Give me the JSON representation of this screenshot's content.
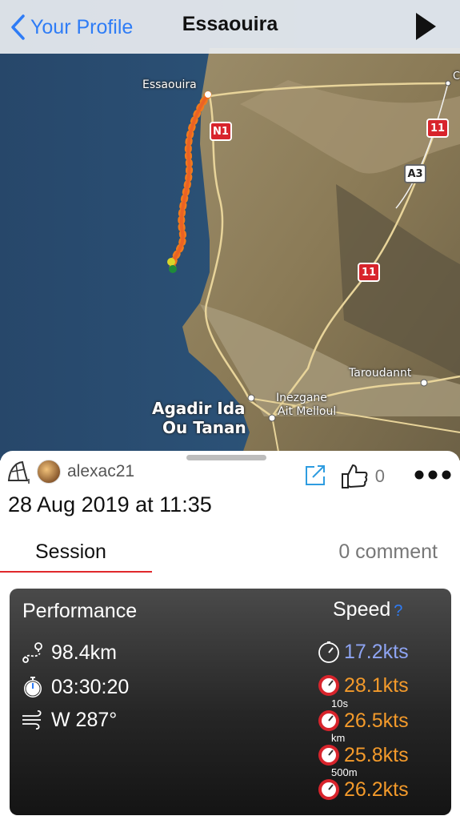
{
  "nav": {
    "back_label": "Your Profile",
    "title": "Essaouira"
  },
  "map": {
    "labels": {
      "essaouira": "Essaouira",
      "agadir_line1": "Agadir Ida",
      "agadir_line2": "Ou Tanan",
      "inezgane_line1": "Inezgane",
      "inezgane_line2": "Ait Melloul",
      "taroudannt": "Taroudannt",
      "edge": "C"
    },
    "roads": {
      "n1": "N1",
      "r11a": "11",
      "a3": "A3",
      "r11b": "11"
    }
  },
  "session": {
    "username": "alexac21",
    "likes": "0",
    "date": "28 Aug 2019 at 11:35"
  },
  "tabs": {
    "session": "Session",
    "comments": "0 comment"
  },
  "performance": {
    "title": "Performance",
    "distance": "98.4km",
    "duration": "03:30:20",
    "wind": "W 287°"
  },
  "speed": {
    "title": "Speed",
    "help": "?",
    "average": "17.2kts",
    "max": "28.1kts",
    "label_10s": "10s",
    "max_10s": "26.5kts",
    "label_km": "km",
    "max_km": "25.8kts",
    "label_500m": "500m",
    "max_500m": "26.2kts"
  },
  "colors": {
    "accent": "#2e7cf6",
    "tab_underline": "#e0282c",
    "speed_avg": "#8ea4f2",
    "speed_max": "#f39a2b",
    "road_badge": "#d8242c"
  }
}
